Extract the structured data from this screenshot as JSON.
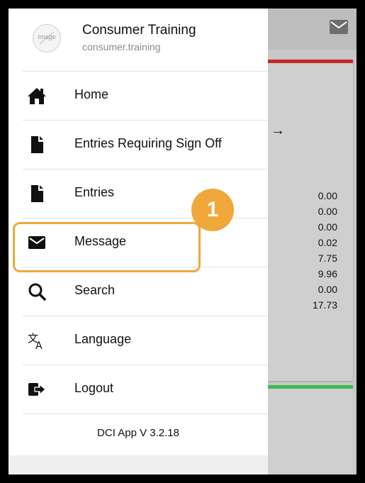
{
  "profile": {
    "avatar_placeholder": "Image",
    "name": "Consumer Training",
    "username": "consumer.training"
  },
  "menu": [
    {
      "label": "Home",
      "icon": "home-icon"
    },
    {
      "label": "Entries Requiring Sign Off",
      "icon": "file-icon"
    },
    {
      "label": "Entries",
      "icon": "file-icon"
    },
    {
      "label": "Message",
      "icon": "envelope-icon"
    },
    {
      "label": "Search",
      "icon": "search-icon"
    },
    {
      "label": "Language",
      "icon": "translate-icon"
    },
    {
      "label": "Logout",
      "icon": "logout-icon"
    }
  ],
  "version": "DCI App V 3.2.18",
  "background": {
    "arrow": "→",
    "values": [
      "0.00",
      "0.00",
      "0.00",
      "0.02",
      "7.75",
      "9.96",
      "0.00",
      "17.73"
    ]
  },
  "annotation": {
    "step": "1",
    "color": "#f0a83a"
  },
  "colors": {
    "card_top": "#c4262b",
    "card2_top": "#3dbb4f"
  }
}
